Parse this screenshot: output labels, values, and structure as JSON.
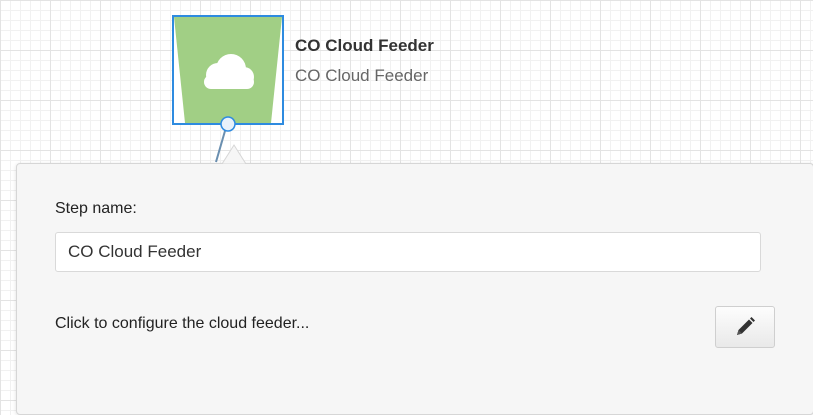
{
  "step": {
    "title": "CO Cloud Feeder",
    "subtitle": "CO Cloud Feeder",
    "icon": "cloud-icon",
    "tile_color": "#a1cf85",
    "selection_color": "#2e8be0"
  },
  "panel": {
    "step_name_label": "Step name:",
    "step_name_value": "CO Cloud Feeder",
    "configure_text": "Click to configure the cloud feeder...",
    "edit_icon": "pencil-icon"
  }
}
